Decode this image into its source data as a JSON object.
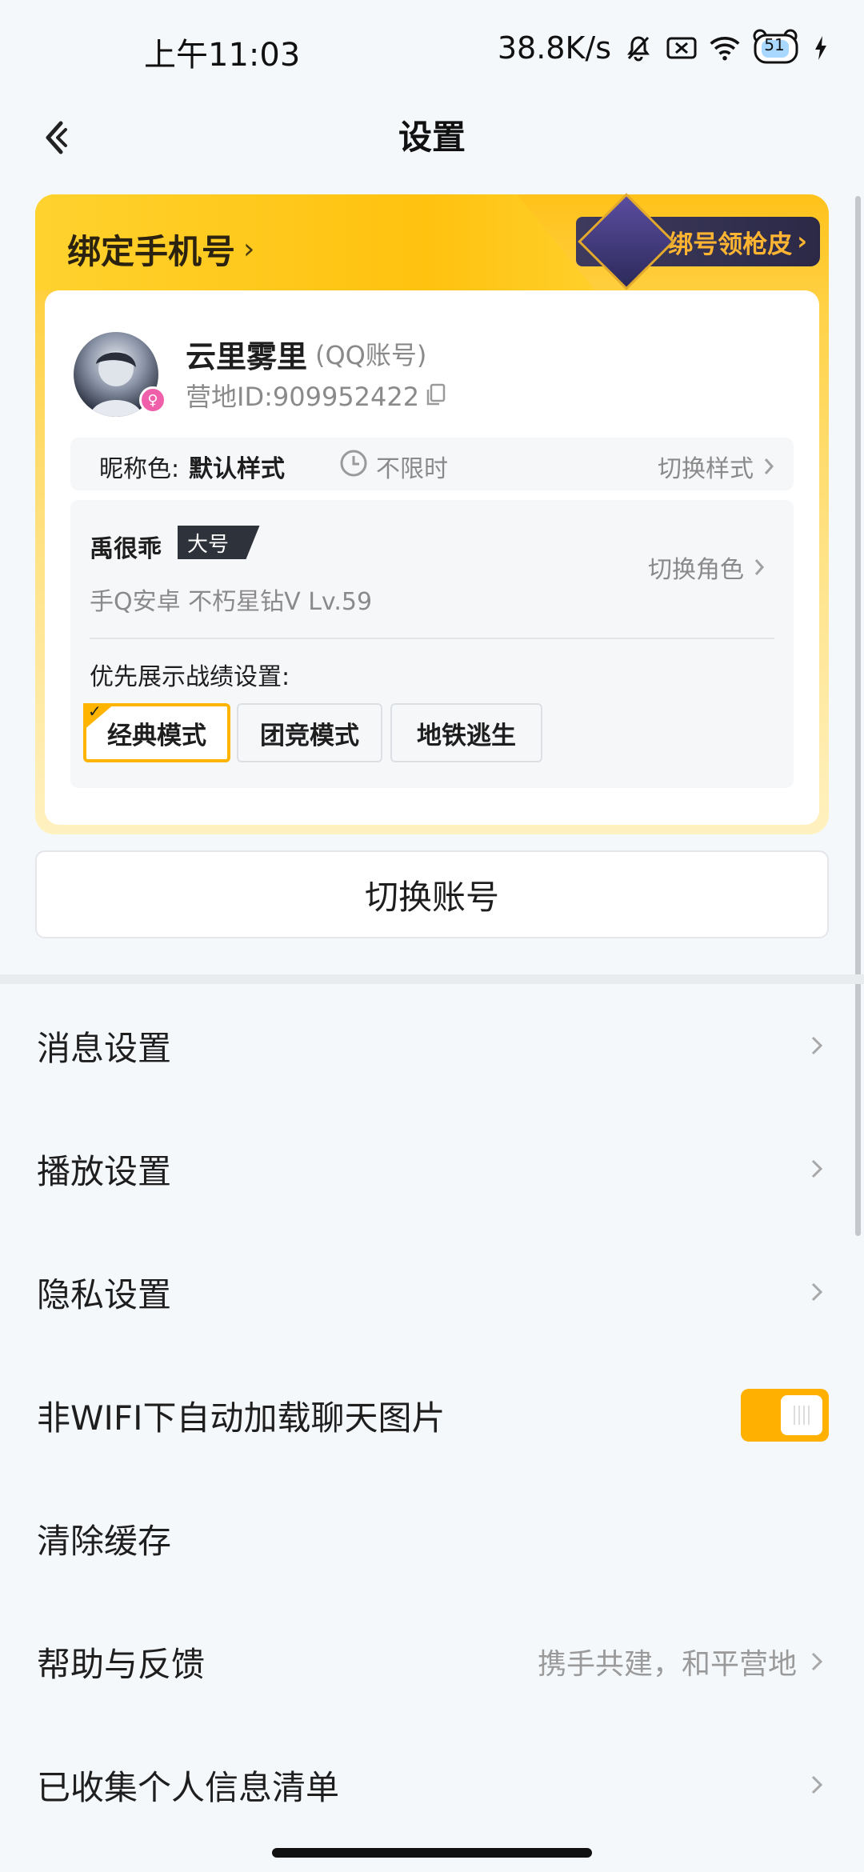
{
  "status_bar": {
    "time": "上午11:03",
    "speed": "38.8K/s",
    "battery": "51"
  },
  "header": {
    "title": "设置"
  },
  "card": {
    "bind_phone": "绑定手机号",
    "promo": "绑号领枪皮",
    "user_name": "云里雾里",
    "account_type": "(QQ账号)",
    "camp_id": "营地ID:909952422",
    "nick_label": "昵称色:",
    "nick_value": "默认样式",
    "nick_time": "不限时",
    "nick_switch": "切换样式",
    "role_name": "禹很乖",
    "role_tag": "大号",
    "role_desc": "手Q安卓  不朽星钻V  Lv.59",
    "role_switch": "切换角色",
    "pref_label": "优先展示战绩设置:",
    "modes": [
      {
        "label": "经典模式",
        "selected": true
      },
      {
        "label": "团竞模式",
        "selected": false
      },
      {
        "label": "地铁逃生",
        "selected": false
      }
    ]
  },
  "switch_account": "切换账号",
  "settings": [
    {
      "label": "消息设置",
      "type": "nav"
    },
    {
      "label": "播放设置",
      "type": "nav"
    },
    {
      "label": "隐私设置",
      "type": "nav"
    },
    {
      "label": "非WIFI下自动加载聊天图片",
      "type": "toggle",
      "on": true
    },
    {
      "label": "清除缓存",
      "type": "plain"
    },
    {
      "label": "帮助与反馈",
      "type": "nav",
      "extra": "携手共建，和平营地"
    },
    {
      "label": "已收集个人信息清单",
      "type": "nav"
    }
  ],
  "colors": {
    "accent": "#ffb000",
    "card_yellow": "#ffc21a",
    "promo_text": "#ffb532"
  }
}
